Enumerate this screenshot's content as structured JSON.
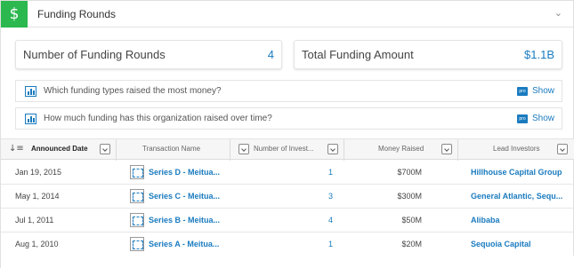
{
  "header": {
    "icon": "dollar-icon",
    "icon_glyph": "$",
    "title": "Funding Rounds",
    "collapse_glyph": "⌄"
  },
  "stats": {
    "rounds_label": "Number of Funding Rounds",
    "rounds_value": "4",
    "amount_label": "Total Funding Amount",
    "amount_value": "$1.1B"
  },
  "questions": [
    {
      "text": "Which funding types raised the most money?",
      "badge": "pro",
      "action": "Show"
    },
    {
      "text": "How much funding has this organization raised over time?",
      "badge": "pro",
      "action": "Show"
    }
  ],
  "table": {
    "sort_glyph": "↓≡",
    "columns": [
      "Announced Date",
      "Transaction Name",
      "Number of Invest...",
      "Money Raised",
      "Lead Investors"
    ],
    "rows": [
      {
        "date": "Jan 19, 2015",
        "transaction": "Series D - Meitua...",
        "investors": "1",
        "money": "$700M",
        "lead": "Hillhouse Capital Group"
      },
      {
        "date": "May 1, 2014",
        "transaction": "Series C - Meitua...",
        "investors": "3",
        "money": "$300M",
        "lead": "General Atlantic, Sequ..."
      },
      {
        "date": "Jul 1, 2011",
        "transaction": "Series B - Meitua...",
        "investors": "4",
        "money": "$50M",
        "lead": "Alibaba"
      },
      {
        "date": "Aug 1, 2010",
        "transaction": "Series A - Meitua...",
        "investors": "1",
        "money": "$20M",
        "lead": "Sequoia Capital"
      }
    ]
  },
  "colors": {
    "accent_green": "#2bb84f",
    "link_blue": "#1a7bbf"
  }
}
